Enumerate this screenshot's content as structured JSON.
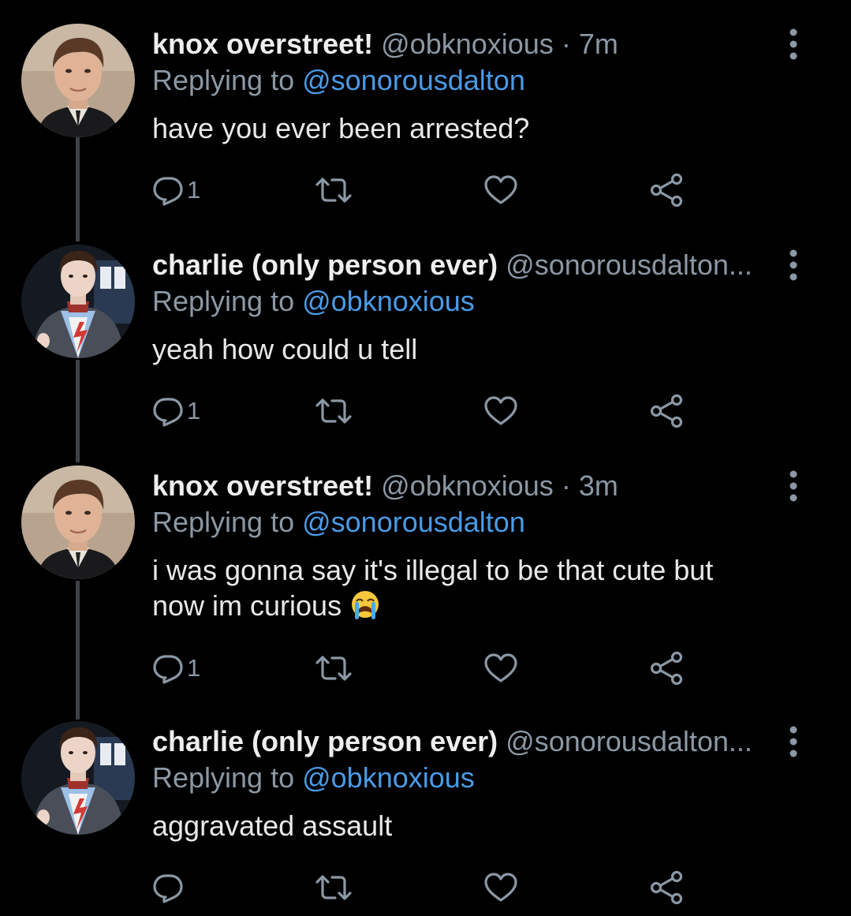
{
  "colors": {
    "background": "#000000",
    "name": "#eeeeee",
    "secondary": "#8b98a5",
    "mention": "#4a9be6",
    "thread_line": "#3d4148"
  },
  "tweets": [
    {
      "name": "knox overstreet!",
      "handle": "@obknoxious",
      "separator": "·",
      "time": "7m",
      "replying_prefix": "Replying to ",
      "replying_to": "@sonorousdalton",
      "text": "have you ever been arrested?",
      "reply_count": "1",
      "avatar": "knox-avatar"
    },
    {
      "name": "charlie (only person ever)",
      "handle": "@sonorousdalton...",
      "replying_prefix": "Replying to ",
      "replying_to": "@obknoxious",
      "text": "yeah how could u tell",
      "reply_count": "1",
      "avatar": "charlie-avatar"
    },
    {
      "name": "knox overstreet!",
      "handle": "@obknoxious",
      "separator": "·",
      "time": "3m",
      "replying_prefix": "Replying to ",
      "replying_to": "@sonorousdalton",
      "text_line1": "i was gonna say it's illegal to be that cute but",
      "text_line2": "now im curious ",
      "emoji": "loudly-crying-face",
      "reply_count": "1",
      "avatar": "knox-avatar"
    },
    {
      "name": "charlie (only person ever)",
      "handle": "@sonorousdalton...",
      "replying_prefix": "Replying to ",
      "replying_to": "@obknoxious",
      "text": "aggravated assault",
      "reply_count": "",
      "avatar": "charlie-avatar"
    }
  ],
  "icons": {
    "reply": "reply-icon",
    "retweet": "retweet-icon",
    "like": "heart-icon",
    "share": "share-icon",
    "more": "more-vertical-icon"
  }
}
